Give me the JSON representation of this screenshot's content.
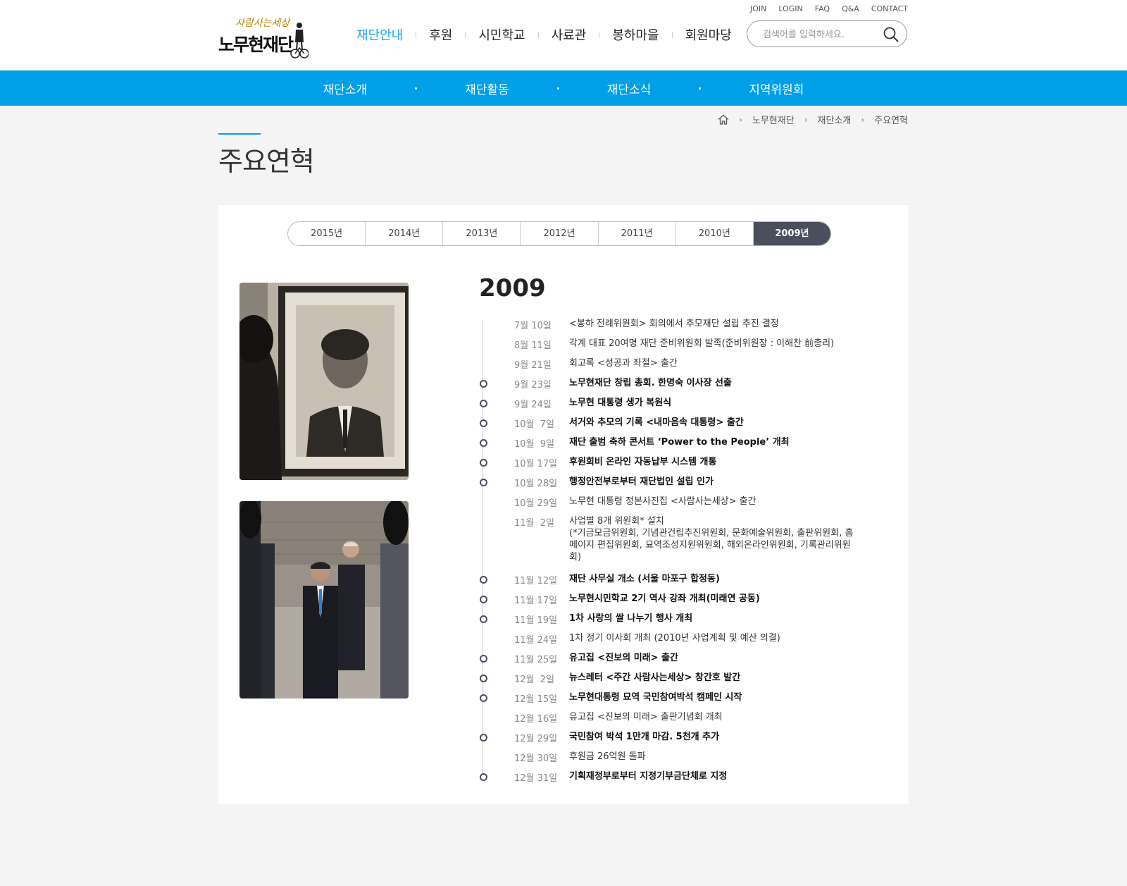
{
  "header": {
    "logo_small": "사람사는세상",
    "logo_main": "노무현재단",
    "util_links": [
      "JOIN",
      "LOGIN",
      "FAQ",
      "Q&A",
      "CONTACT"
    ],
    "gnb": [
      "재단안내",
      "후원",
      "시민학교",
      "사료관",
      "봉하마을",
      "회원마당"
    ],
    "search_placeholder": "검색어를 입력하세요."
  },
  "subnav": [
    "재단소개",
    "재단활동",
    "재단소식",
    "지역위원회"
  ],
  "breadcrumb": [
    "노무현재단",
    "재단소개",
    "주요연혁"
  ],
  "page_title": "주요연혁",
  "year_tabs": [
    "2015년",
    "2014년",
    "2013년",
    "2012년",
    "2011년",
    "2010년",
    "2009년"
  ],
  "active_year_index": 6,
  "year_heading": "2009",
  "accent_color": "#00a0e9",
  "events": [
    {
      "date": "7월 10일",
      "text": "<봉하 전례위원회> 회의에서 추모재단 설립 추진 결정",
      "bold": false
    },
    {
      "date": "8월 11일",
      "text": "각계 대표 20여명 재단 준비위원회 발족(준비위원장 : 이해찬 前총리)",
      "bold": false
    },
    {
      "date": "9월 21일",
      "text": "회고록 <성공과 좌절> 출간",
      "bold": false
    },
    {
      "date": "9월 23일",
      "text": "노무현재단 창립 총회. 한명숙 이사장 선출",
      "bold": true
    },
    {
      "date": "9월 24일",
      "text": "노무현 대통령 생가 복원식",
      "bold": true
    },
    {
      "date": "10월  7일",
      "text": "서거와 추모의 기록 <내마음속 대통령> 출간",
      "bold": true
    },
    {
      "date": "10월  9일",
      "text": "재단 출범 축하 콘서트 ‘Power to the People’ 개최",
      "bold": true
    },
    {
      "date": "10월 17일",
      "text": "후원회비 온라인 자동납부 시스템 개통",
      "bold": true
    },
    {
      "date": "10월 28일",
      "text": "행정안전부로부터 재단법인 설립 인가",
      "bold": true
    },
    {
      "date": "10월 29일",
      "text": "노무현 대통령 정본사진집 <사람사는세상> 출간",
      "bold": false
    },
    {
      "date": "11월  2일",
      "text": "사업별 8개 위원회* 설치",
      "bold": false,
      "detail": "(*기금모금위원회, 기념관건립추진위원회, 문화예술위원회, 출판위원회, 홈페이지 편집위원회, 묘역조성지원위원회, 해외온라인위원회, 기록관리위원회)"
    },
    {
      "date": "11월 12일",
      "text": "재단 사무실 개소 (서울 마포구 합정동)",
      "bold": true
    },
    {
      "date": "11월 17일",
      "text": "노무현시민학교 2기 역사 강좌 개최(미래연 공동)",
      "bold": true
    },
    {
      "date": "11월 19일",
      "text": "1차 사랑의 쌀 나누기 행사 개최",
      "bold": true
    },
    {
      "date": "11월 24일",
      "text": "1차 정기 이사회 개최 (2010년 사업계획 및 예산 의결)",
      "bold": false
    },
    {
      "date": "11월 25일",
      "text": "유고집 <진보의 미래> 출간",
      "bold": true
    },
    {
      "date": "12월  2일",
      "text": "뉴스레터 <주간 사람사는세상> 창간호 발간",
      "bold": true
    },
    {
      "date": "12월 15일",
      "text": "노무현대통령 묘역 국민참여박석 캠페인 시작",
      "bold": true
    },
    {
      "date": "12월 16일",
      "text": "유고집 <진보의 미래> 출판기념회 개최",
      "bold": false
    },
    {
      "date": "12월 29일",
      "text": "국민참여 박석 1만개 마감. 5천개 추가",
      "bold": true
    },
    {
      "date": "12월 30일",
      "text": "후원금 26억원 돌파",
      "bold": false
    },
    {
      "date": "12월 31일",
      "text": "기획재정부로부터 지정기부금단체로 지정",
      "bold": true
    }
  ]
}
